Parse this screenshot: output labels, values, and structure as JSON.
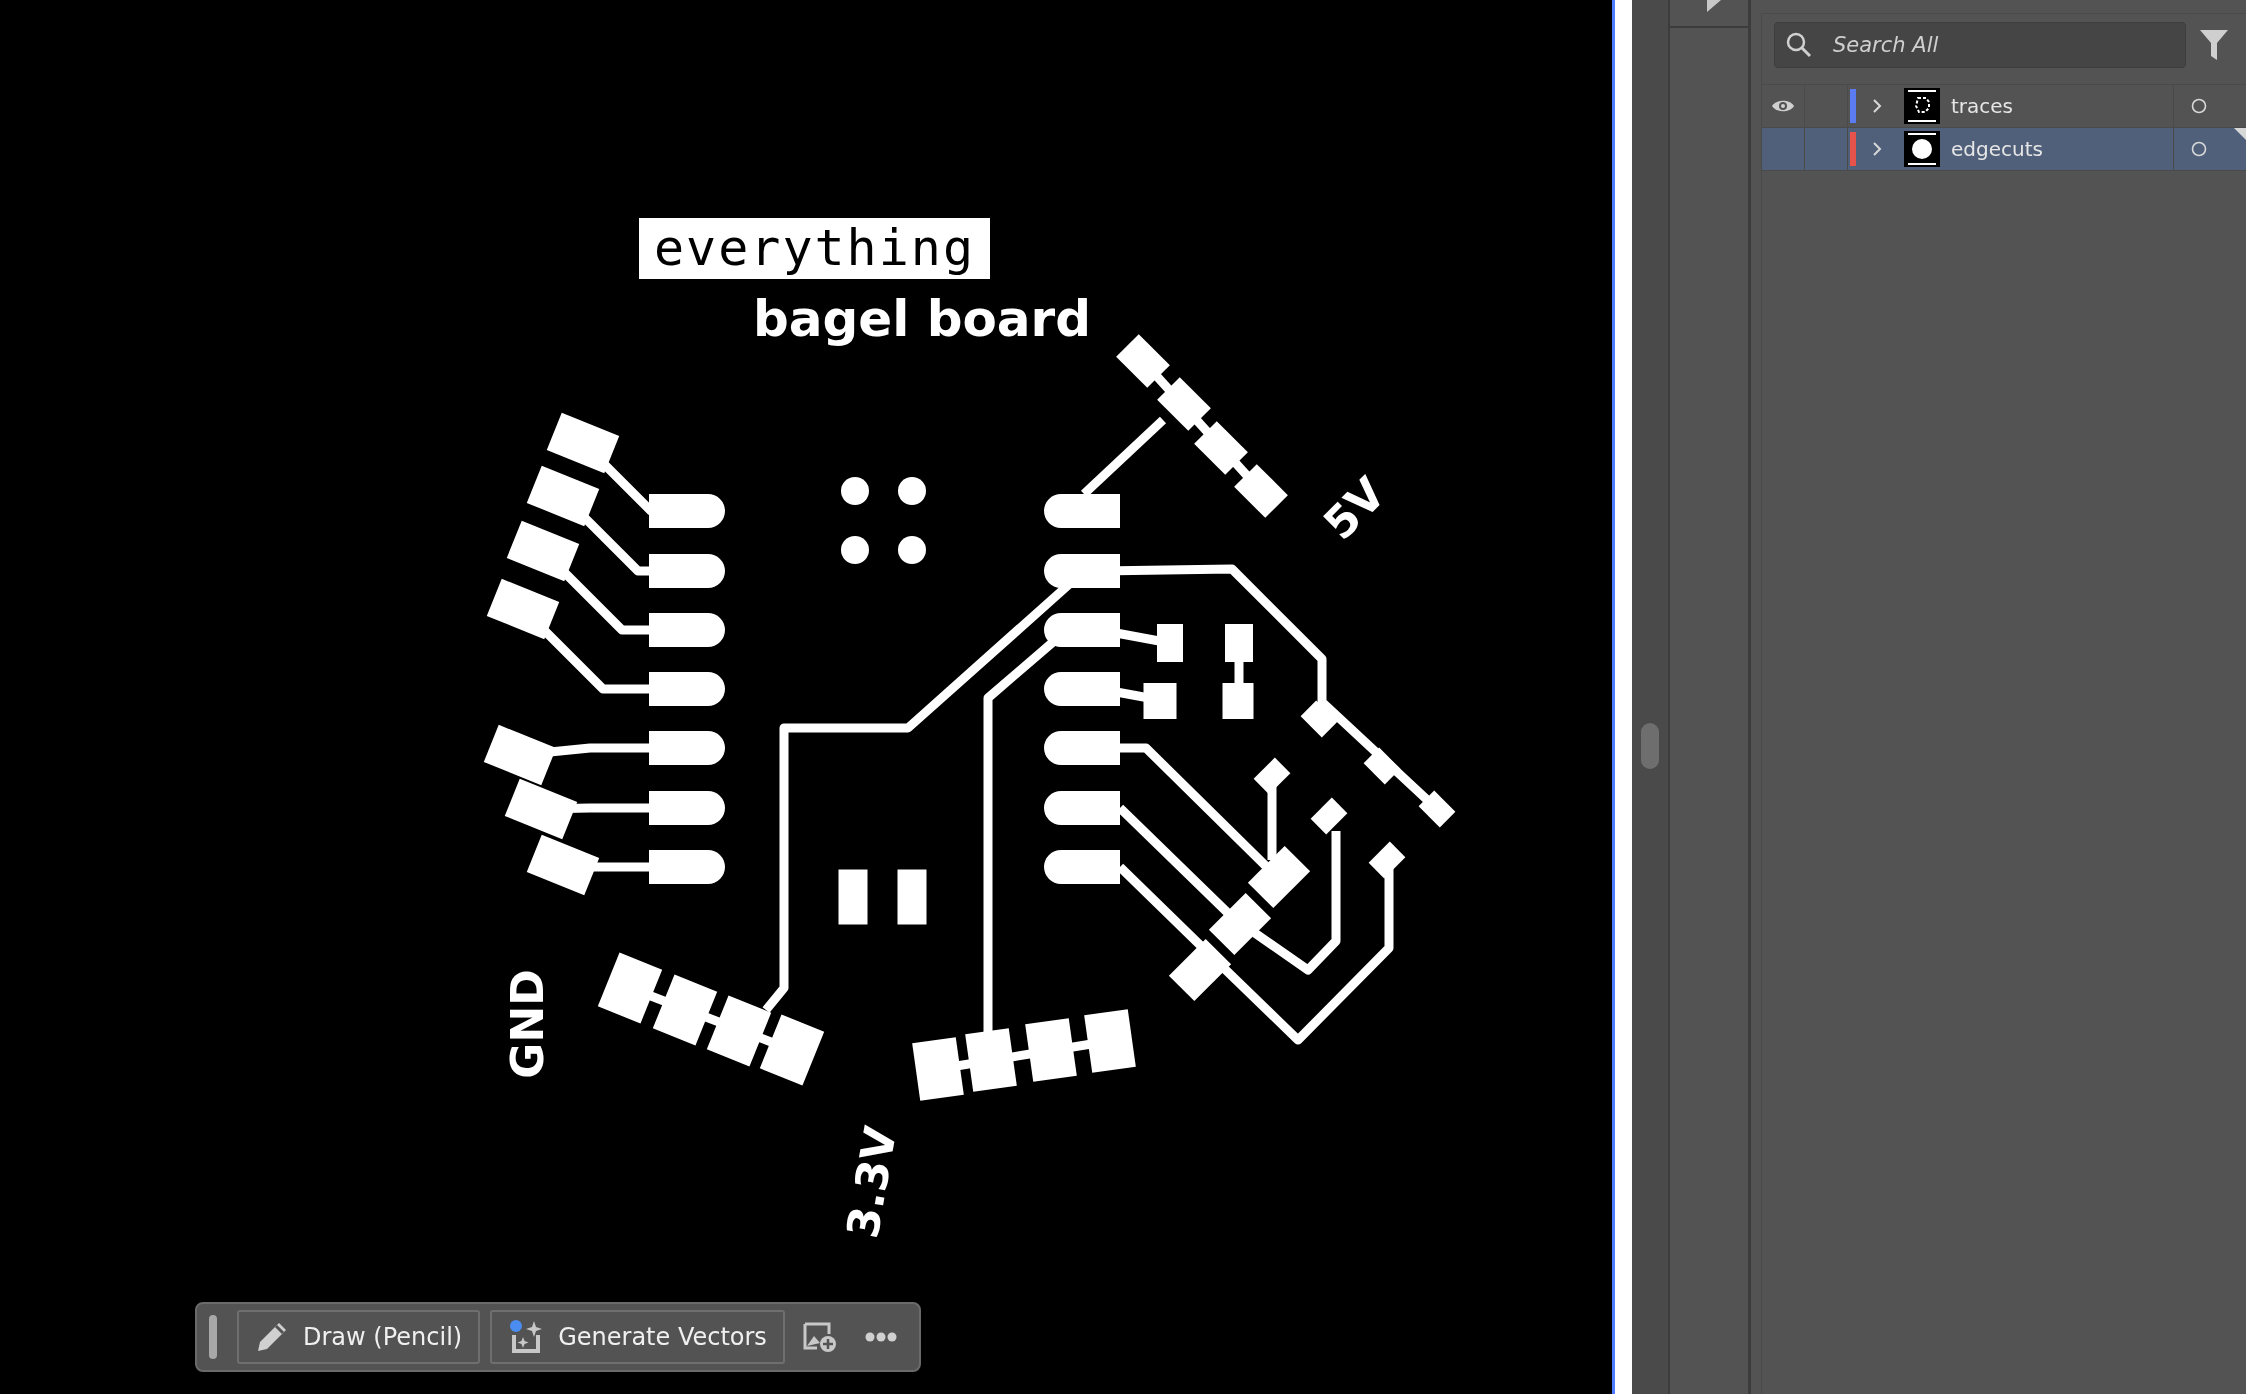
{
  "board": {
    "title": "everything",
    "subtitle": "bagel board",
    "pin_labels": [
      "5V",
      "GND",
      "3.3V"
    ]
  },
  "toolbar": {
    "buttons": [
      {
        "label": "Draw (Pencil)",
        "kind": "pencil"
      },
      {
        "label": "Generate Vectors",
        "kind": "generate"
      }
    ]
  },
  "layers_panel": {
    "search": {
      "placeholder": "Search All"
    },
    "layers": [
      {
        "name": "traces",
        "color": "#5b7cf0",
        "visible": true,
        "selected": false,
        "kind": "traces"
      },
      {
        "name": "edgecuts",
        "color": "#e5534b",
        "visible": false,
        "selected": true,
        "kind": "edgecuts"
      }
    ]
  }
}
